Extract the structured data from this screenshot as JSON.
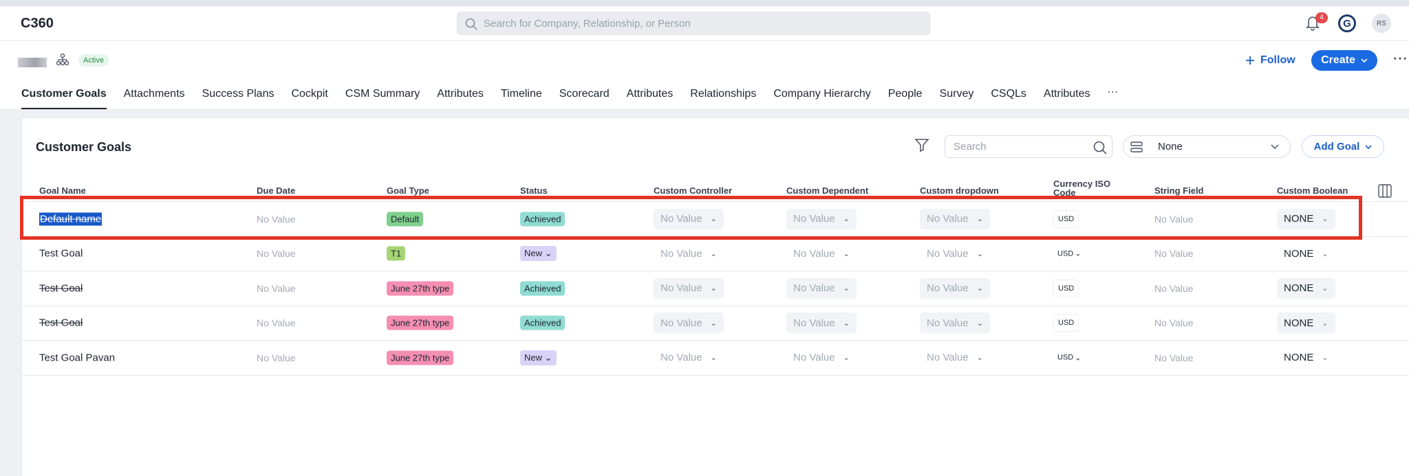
{
  "app": {
    "title": "C360",
    "global_search_placeholder": "Search for Company, Relationship, or Person",
    "notification_count": "4",
    "logo_letter": "G",
    "user_initials": "RS"
  },
  "company": {
    "status": "Active",
    "follow_label": "Follow",
    "create_label": "Create"
  },
  "tabs": [
    {
      "label": "Customer Goals",
      "active": true
    },
    {
      "label": "Attachments"
    },
    {
      "label": "Success Plans"
    },
    {
      "label": "Cockpit"
    },
    {
      "label": "CSM Summary"
    },
    {
      "label": "Attributes"
    },
    {
      "label": "Timeline"
    },
    {
      "label": "Scorecard"
    },
    {
      "label": "Attributes"
    },
    {
      "label": "Relationships"
    },
    {
      "label": "Company Hierarchy"
    },
    {
      "label": "People"
    },
    {
      "label": "Survey"
    },
    {
      "label": "CSQLs"
    },
    {
      "label": "Attributes"
    }
  ],
  "goals": {
    "title": "Customer Goals",
    "search_placeholder": "Search",
    "view_select": "None",
    "add_goal_label": "Add Goal",
    "columns": [
      "Goal Name",
      "Due Date",
      "Goal Type",
      "Status",
      "Custom Controller",
      "Custom Dependent",
      "Custom dropdown",
      "Currency ISO Code",
      "String Field",
      "Custom Boolean"
    ],
    "rows": [
      {
        "name": "Default name",
        "due": "No Value",
        "type": "Default",
        "status": "Achieved",
        "controller": "No Value",
        "dependent": "No Value",
        "dropdown": "No Value",
        "currency": "USD",
        "string": "No Value",
        "boolean": "NONE"
      },
      {
        "name": "Test Goal",
        "due": "No Value",
        "type": "T1",
        "status": "New",
        "controller": "No Value",
        "dependent": "No Value",
        "dropdown": "No Value",
        "currency": "USD",
        "string": "No Value",
        "boolean": "NONE"
      },
      {
        "name": "Test Goal",
        "due": "No Value",
        "type": "June 27th type",
        "status": "Achieved",
        "controller": "No Value",
        "dependent": "No Value",
        "dropdown": "No Value",
        "currency": "USD",
        "string": "No Value",
        "boolean": "NONE"
      },
      {
        "name": "Test Goal",
        "due": "No Value",
        "type": "June 27th type",
        "status": "Achieved",
        "controller": "No Value",
        "dependent": "No Value",
        "dropdown": "No Value",
        "currency": "USD",
        "string": "No Value",
        "boolean": "NONE"
      },
      {
        "name": "Test Goal Pavan",
        "due": "No Value",
        "type": "June 27th type",
        "status": "New",
        "controller": "No Value",
        "dependent": "No Value",
        "dropdown": "No Value",
        "currency": "USD",
        "string": "No Value",
        "boolean": "NONE"
      }
    ]
  },
  "colors": {
    "accent": "#1a6ae3",
    "highlight": "#e43424"
  }
}
